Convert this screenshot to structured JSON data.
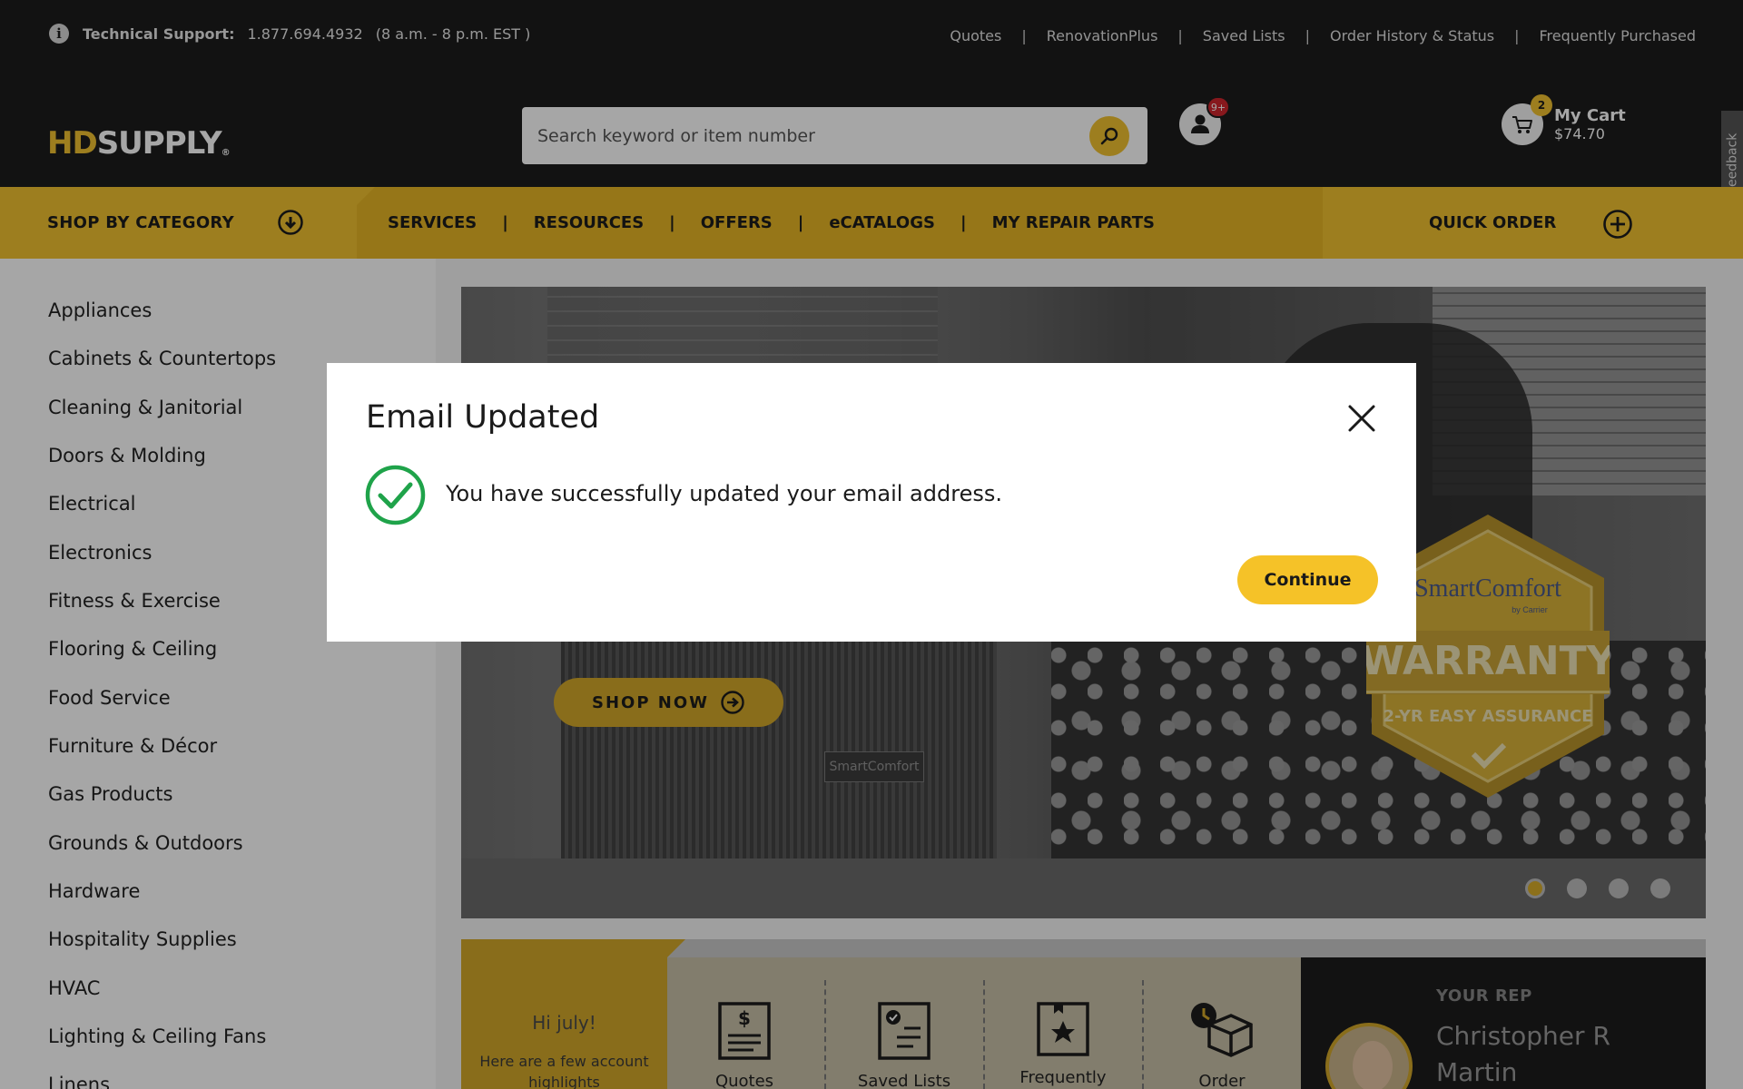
{
  "utility_bar": {
    "support_label": "Technical Support:",
    "support_phone": "1.877.694.4932",
    "support_hours": "(8 a.m. - 8 p.m. EST )",
    "links": [
      "Quotes",
      "RenovationPlus",
      "Saved Lists",
      "Order History & Status",
      "Frequently Purchased"
    ],
    "separator": "|"
  },
  "header": {
    "logo_hd": "HD",
    "logo_supply": "SUPPLY",
    "logo_tm": "®",
    "search_placeholder": "Search keyword or item number",
    "account_badge": "9+",
    "cart_count": "2",
    "cart_label": "My Cart",
    "cart_total": "$74.70",
    "feedback_label": "Give Feedback"
  },
  "nav": {
    "category_label": "SHOP BY CATEGORY",
    "items": [
      "SERVICES",
      "RESOURCES",
      "OFFERS",
      "eCATALOGS",
      "MY REPAIR PARTS"
    ],
    "separator": "|",
    "quick_order_label": "QUICK ORDER"
  },
  "sidebar": {
    "categories": [
      "Appliances",
      "Cabinets & Countertops",
      "Cleaning & Janitorial",
      "Doors & Molding",
      "Electrical",
      "Electronics",
      "Fitness & Exercise",
      "Flooring & Ceiling",
      "Food Service",
      "Furniture & Décor",
      "Gas Products",
      "Grounds & Outdoors",
      "Hardware",
      "Hospitality Supplies",
      "HVAC",
      "Lighting & Ceiling Fans",
      "Linens"
    ]
  },
  "hero": {
    "shop_now_label": "SHOP NOW",
    "unit_logo": "SmartComfort",
    "badge_brand": "SmartComfort",
    "badge_by": "by Carrier",
    "badge_title": "WARRANTY",
    "badge_sub": "2-YR EASY ASSURANCE",
    "slide_count": 4,
    "active_slide": 1
  },
  "account_strip": {
    "greeting": "Hi july!",
    "subtext": "Here are a few account highlights",
    "highlights": [
      "Quotes",
      "Saved Lists",
      "Frequently",
      "Order"
    ],
    "rep_title": "YOUR REP",
    "rep_name": "Christopher R Martin"
  },
  "modal": {
    "title": "Email Updated",
    "message": "You have successfully updated your email address.",
    "continue_label": "Continue"
  },
  "colors": {
    "brand_yellow": "#f2c230",
    "dark": "#1c1c1c",
    "success_green": "#1fa34a"
  }
}
